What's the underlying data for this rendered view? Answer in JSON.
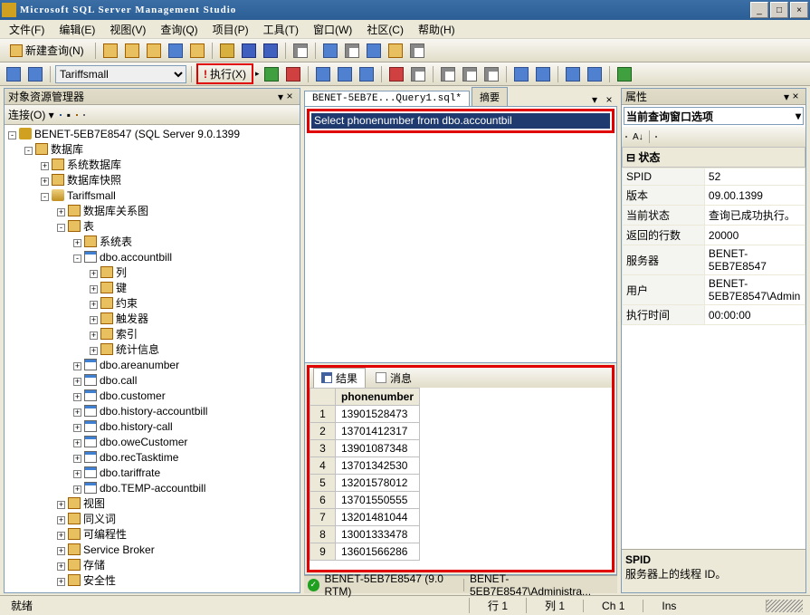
{
  "window": {
    "title": "Microsoft SQL Server Management Studio"
  },
  "menus": [
    "文件(F)",
    "编辑(E)",
    "视图(V)",
    "查询(Q)",
    "项目(P)",
    "工具(T)",
    "窗口(W)",
    "社区(C)",
    "帮助(H)"
  ],
  "toolbar1": {
    "newquery": "新建查询(N)"
  },
  "toolbar2": {
    "db": "Tariffsmall",
    "exec": "执行(X)"
  },
  "objexp": {
    "title": "对象资源管理器",
    "connect": "连接(O)",
    "server": "BENET-5EB7E8547 (SQL Server 9.0.1399",
    "dbroot": "数据库",
    "sysdb": "系统数据库",
    "snap": "数据库快照",
    "userdb": "Tariffsmall",
    "dbdiag": "数据库关系图",
    "tables": "表",
    "systables": "系统表",
    "curtable": "dbo.accountbill",
    "cols": "列",
    "keys": "键",
    "constr": "约束",
    "trig": "触发器",
    "idx": "索引",
    "stats": "统计信息",
    "othertables": [
      "dbo.areanumber",
      "dbo.call",
      "dbo.customer",
      "dbo.history-accountbill",
      "dbo.history-call",
      "dbo.oweCustomer",
      "dbo.recTasktime",
      "dbo.tariffrate",
      "dbo.TEMP-accountbill"
    ],
    "views": "视图",
    "syn": "同义词",
    "prog": "可编程性",
    "sb": "Service Broker",
    "stor": "存储",
    "sec": "安全性"
  },
  "doc": {
    "tab1": "BENET-5EB7E...Query1.sql*",
    "tab2": "摘要",
    "sql": "Select phonenumber from dbo.accountbil"
  },
  "results": {
    "tab_result": "结果",
    "tab_msg": "消息",
    "col": "phonenumber",
    "rows": [
      "13901528473",
      "13701412317",
      "13901087348",
      "13701342530",
      "13201578012",
      "13701550555",
      "13201481044",
      "13001333478",
      "13601566286"
    ]
  },
  "qstatus": {
    "server": "BENET-5EB7E8547 (9.0 RTM)",
    "user": "BENET-5EB7E8547\\Administra..."
  },
  "props": {
    "title": "属性",
    "selection": "当前查询窗口选项",
    "cat_state": "状态",
    "rows": [
      {
        "k": "SPID",
        "v": "52"
      },
      {
        "k": "版本",
        "v": "09.00.1399"
      },
      {
        "k": "当前状态",
        "v": "查询已成功执行。"
      },
      {
        "k": "返回的行数",
        "v": "20000"
      },
      {
        "k": "服务器",
        "v": "BENET-5EB7E8547"
      },
      {
        "k": "用户",
        "v": "BENET-5EB7E8547\\Admin"
      },
      {
        "k": "执行时间",
        "v": "00:00:00"
      }
    ],
    "desc_title": "SPID",
    "desc_body": "服务器上的线程 ID。"
  },
  "statusbar": {
    "ready": "就绪",
    "line": "行 1",
    "col": "列 1",
    "ch": "Ch 1",
    "ins": "Ins"
  }
}
